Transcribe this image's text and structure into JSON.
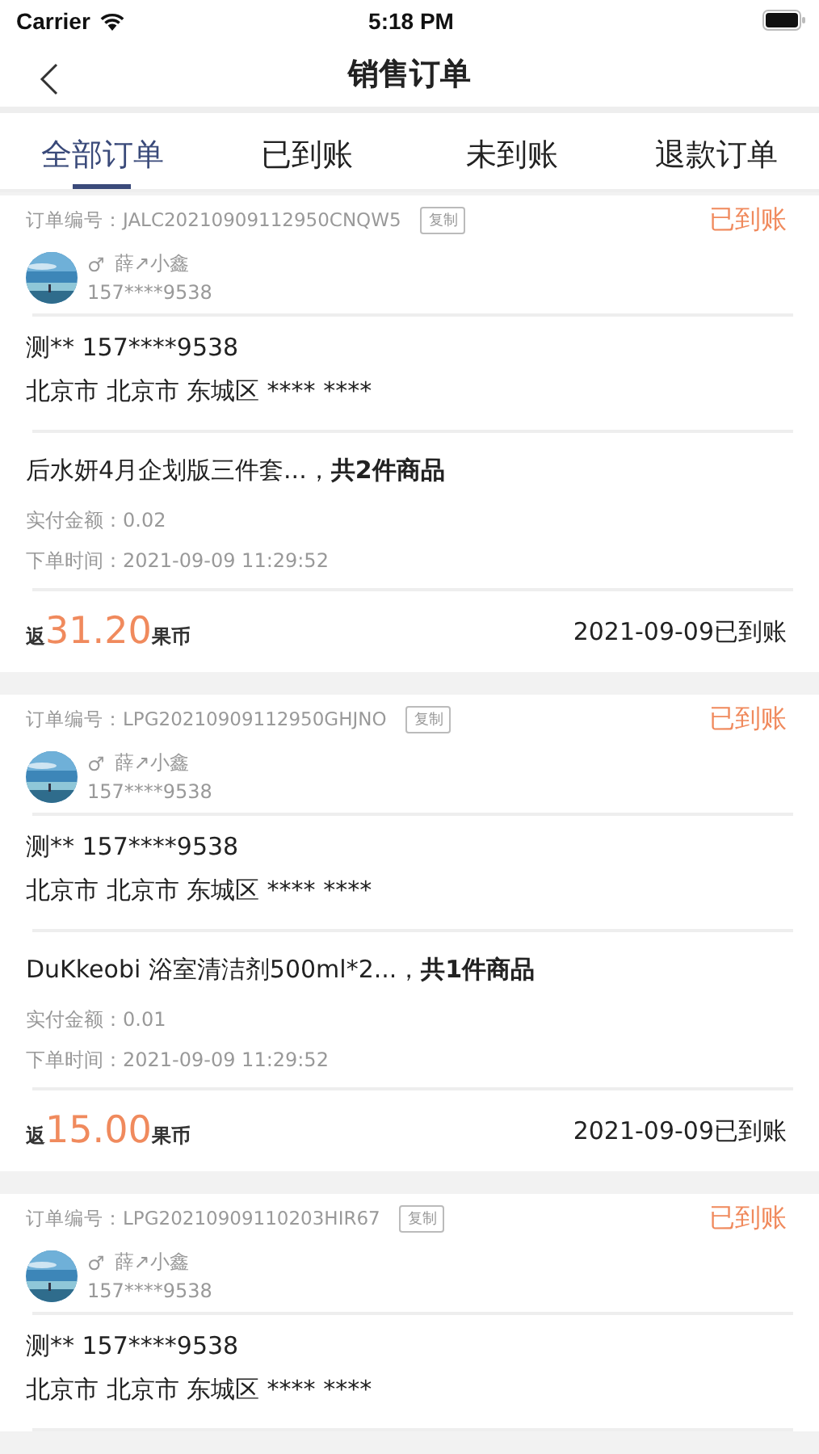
{
  "status_bar": {
    "carrier": "Carrier",
    "time": "5:18 PM"
  },
  "nav": {
    "title": "销售订单"
  },
  "tabs": [
    {
      "label": "全部订单",
      "selected": true
    },
    {
      "label": "已到账",
      "selected": false
    },
    {
      "label": "未到账",
      "selected": false
    },
    {
      "label": "退款订单",
      "selected": false
    }
  ],
  "orders": [
    {
      "order_no": "订单编号：JALC20210909112950CNQW5",
      "copy": "复制",
      "status": "已到账",
      "gender": "♂",
      "user_name": "薛↗小鑫",
      "user_phone": "157****9538",
      "recipient": "测** 157****9538",
      "address": "北京市 北京市 东城区 **** ****",
      "product": "后水妍4月企划版三件套...，**共2件商品**",
      "paid": "实付金额：0.02",
      "time": "下单时间：2021-09-09 11:29:52",
      "rebate_prefix": "返",
      "rebate": "31.20",
      "rebate_unit": "果币",
      "arrival": "2021-09-09已到账"
    },
    {
      "order_no": "订单编号：LPG20210909112950GHJNO",
      "copy": "复制",
      "status": "已到账",
      "gender": "♂",
      "user_name": "薛↗小鑫",
      "user_phone": "157****9538",
      "recipient": "测** 157****9538",
      "address": "北京市 北京市 东城区 **** ****",
      "product": "DuKkeobi 浴室清洁剂500ml*2...，**共1件商品**",
      "paid": "实付金额：0.01",
      "time": "下单时间：2021-09-09 11:29:52",
      "rebate_prefix": "返",
      "rebate": "15.00",
      "rebate_unit": "果币",
      "arrival": "2021-09-09已到账"
    },
    {
      "order_no": "订单编号：LPG20210909110203HIR67",
      "copy": "复制",
      "status": "已到账",
      "gender": "♂",
      "user_name": "薛↗小鑫",
      "user_phone": "157****9538",
      "recipient": "测** 157****9538",
      "address": "北京市 北京市 东城区 **** ****"
    }
  ]
}
